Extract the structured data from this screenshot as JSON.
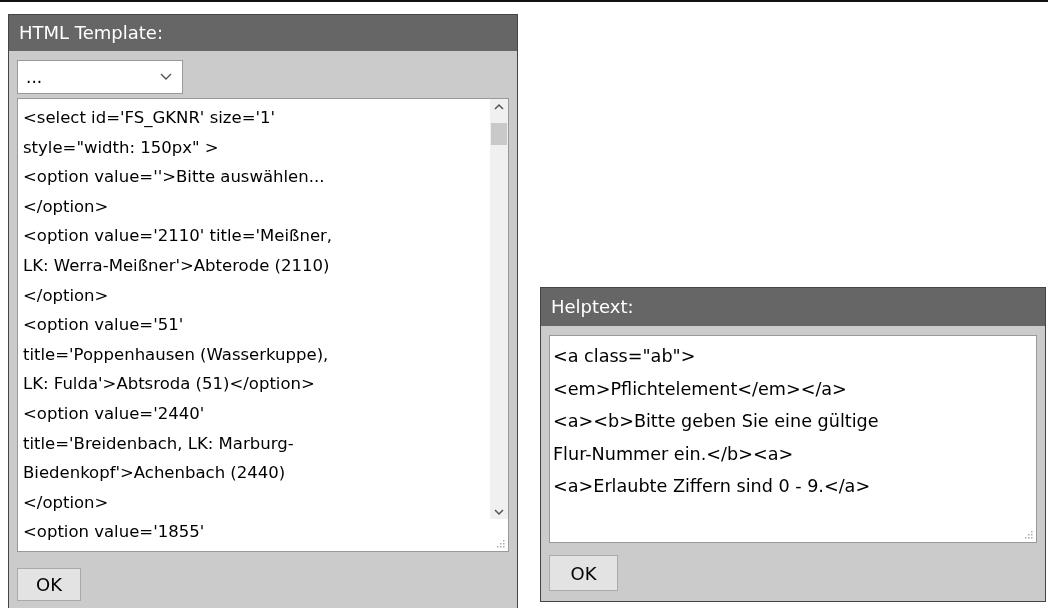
{
  "dialogs": [
    {
      "title": "HTML Template:",
      "dropdown": {
        "value": "..."
      },
      "scrollbar": true,
      "text": [
        "<select id='FS_GKNR' size='1'",
        "style=\"width: 150px\" >",
        "<option value=''>Bitte auswählen...",
        "</option>",
        "<option value='2110' title='Meißner,",
        "LK: Werra-Meißner'>Abterode (2110)",
        "</option>",
        "<option value='51'",
        "title='Poppenhausen (Wasserkuppe),",
        "LK: Fulda'>Abtsroda (51)</option>",
        "<option value='2440'",
        "title='Breidenbach, LK: Marburg-",
        "Biedenkopf'>Achenbach (2440)",
        "</option>",
        "<option value='1855'"
      ],
      "button": "OK"
    },
    {
      "title": "Helptext:",
      "text": [
        "<a class=\"ab\">",
        "<em>Pflichtelement</em></a>",
        "<a><b>Bitte geben Sie eine gültige",
        "Flur-Nummer ein.</b><a>",
        "<a>Erlaubte Ziffern sind 0 - 9.</a>"
      ],
      "button": "OK"
    }
  ]
}
